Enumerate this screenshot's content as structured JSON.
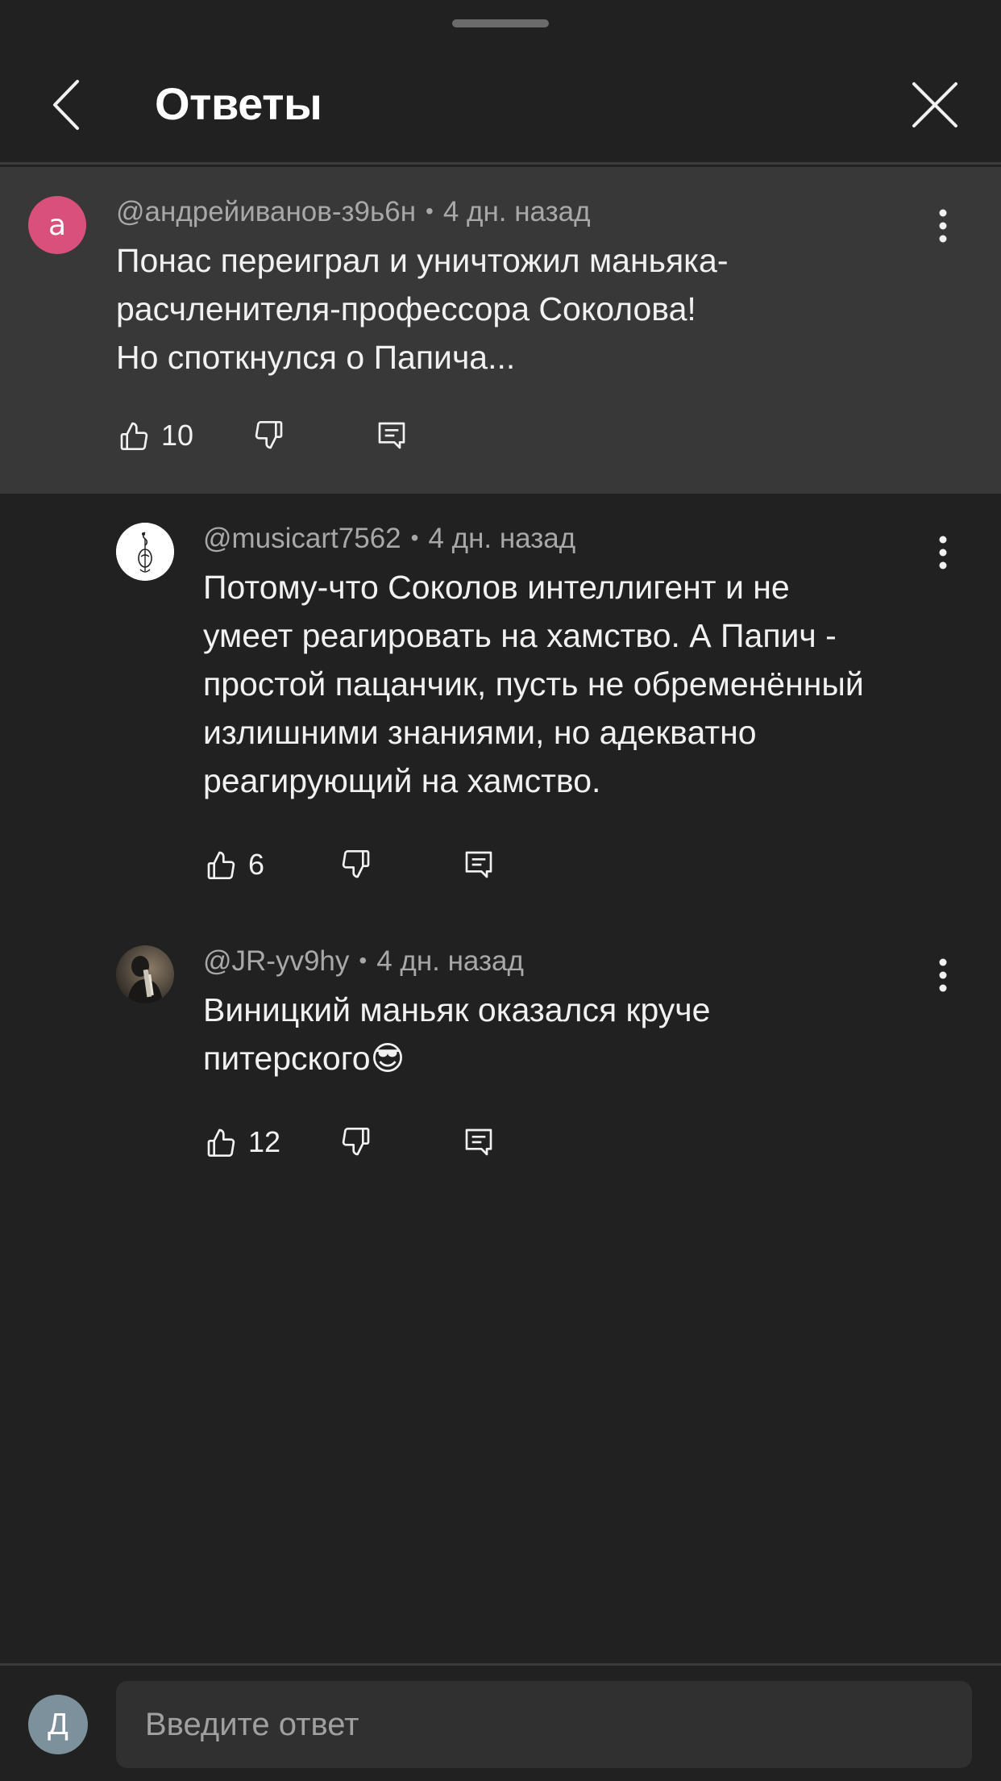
{
  "header": {
    "title": "Ответы",
    "back_icon": "chevron-left-icon",
    "close_icon": "close-icon"
  },
  "comments": [
    {
      "author": "@андрейиванов-з9ь6н",
      "time": "4 дн. назад",
      "avatar_letter": "а",
      "avatar_color": "#d9507d",
      "text": "Понас переиграл и уничтожил маньяка-\nрасчленителя-профессора Соколова!\nНо споткнулся о Папича...",
      "likes": "10"
    },
    {
      "author": "@musicart7562",
      "time": "4 дн. назад",
      "avatar_icon": "violin-icon",
      "text": "Потому-что Соколов интеллигент и не\nумеет реагировать на хамство. А Папич -\nпростой пацанчик, пусть не обременённый\nизлишними знаниями, но адекватно\nреагирующий на хамство.",
      "likes": "6"
    },
    {
      "author": "@JR-yv9hy",
      "time": "4 дн. назад",
      "avatar_icon": "person-photo-icon",
      "text": "Виницкий маньяк оказался круче\nпитерского",
      "emoji": "😎",
      "likes": "12"
    }
  ],
  "reply": {
    "user_avatar_letter": "Д",
    "user_avatar_color": "#7d919c",
    "placeholder": "Введите ответ"
  },
  "colors": {
    "background": "#212121",
    "parent_highlight": "#383838",
    "text_primary": "#f1f1f1",
    "text_secondary": "#a8a8a8"
  }
}
